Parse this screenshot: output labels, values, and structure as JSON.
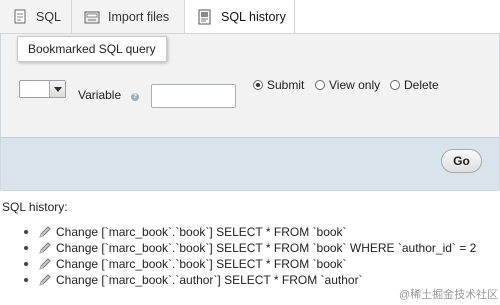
{
  "tabs": [
    {
      "label": "SQL",
      "icon": "sql-page-icon",
      "active": false
    },
    {
      "label": "Import files",
      "icon": "import-files-icon",
      "active": false
    },
    {
      "label": "SQL history",
      "icon": "sql-history-icon",
      "active": true
    }
  ],
  "form": {
    "legend": "Bookmarked SQL query",
    "variable_label": "Variable",
    "variable_value": "",
    "radio": {
      "submit": "Submit",
      "view_only": "View only",
      "delete": "Delete",
      "selected": "submit"
    },
    "go_label": "Go"
  },
  "history": {
    "title": "SQL history:",
    "items": [
      "Change [`marc_book`.`book`] SELECT * FROM `book`",
      "Change [`marc_book`.`book`] SELECT * FROM `book` WHERE `author_id` = 2",
      "Change [`marc_book`.`book`] SELECT * FROM `book`",
      "Change [`marc_book`.`author`] SELECT * FROM `author`"
    ]
  },
  "watermark": "@稀土掘金技术社区",
  "colors": {
    "panel_bg": "#f2f2f2",
    "footer_bg": "#d9e3eb",
    "tab_inactive_bg": "#f3f3f3"
  }
}
